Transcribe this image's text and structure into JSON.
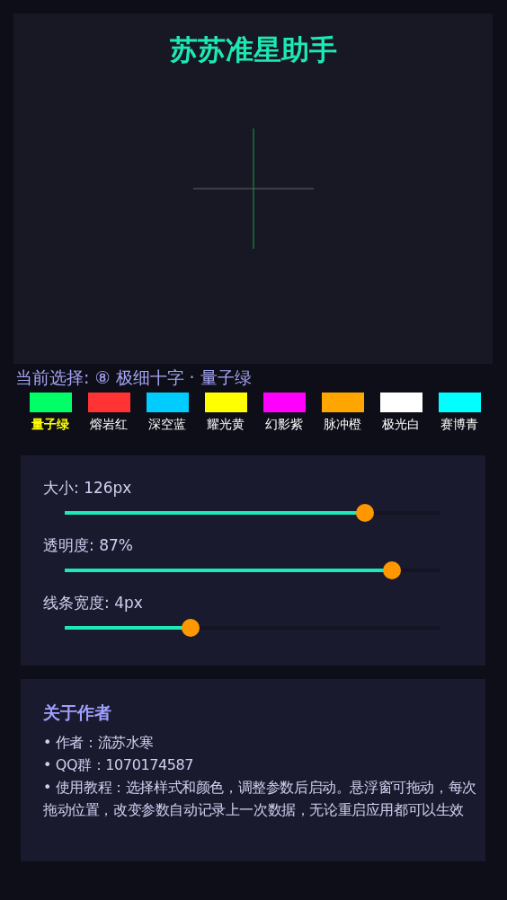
{
  "app_title": "苏苏准星助手",
  "current_selection": "当前选择: ⑧ 极细十字 · 量子绿",
  "colors": [
    {
      "label": "量子绿",
      "color": "#00ff66",
      "selected": true
    },
    {
      "label": "熔岩红",
      "color": "#ff3333",
      "selected": false
    },
    {
      "label": "深空蓝",
      "color": "#00ccff",
      "selected": false
    },
    {
      "label": "耀光黄",
      "color": "#ffff00",
      "selected": false
    },
    {
      "label": "幻影紫",
      "color": "#ff00ff",
      "selected": false
    },
    {
      "label": "脉冲橙",
      "color": "#ffa500",
      "selected": false
    },
    {
      "label": "极光白",
      "color": "#ffffff",
      "selected": false
    },
    {
      "label": "赛博青",
      "color": "#00ffff",
      "selected": false
    }
  ],
  "sliders": [
    {
      "label": "大小: 126px",
      "level": 0.8
    },
    {
      "label": "透明度: 87%",
      "level": 0.87
    },
    {
      "label": "线条宽度: 4px",
      "level": 0.335
    }
  ],
  "about": {
    "title": "关于作者",
    "lines": [
      "• 作者：流苏水寒",
      "• QQ群：1070174587",
      "• 使用教程：选择样式和颜色，调整参数后启动。悬浮窗可拖动，每次拖动位置，改变参数自动记录上一次数据，无论重启应用都可以生效"
    ]
  }
}
